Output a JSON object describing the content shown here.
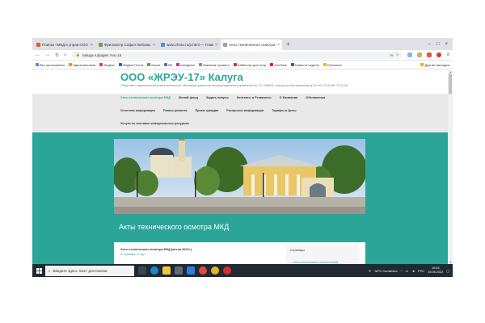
{
  "browser": {
    "tabs": [
      {
        "label": "Поиски «МКД в управ ООО Ж",
        "color": "#e8582c",
        "active": false
      },
      {
        "label": "Фрилансер Софья Любова н",
        "color": "#7a9a4b",
        "active": false
      },
      {
        "label": "www.zhrau.ru/p.html — Главная управ",
        "color": "#4a8fd8",
        "active": false
      },
      {
        "label": "Акты технического осмотра МКД",
        "color": "#9aa0a6",
        "active": true
      }
    ],
    "new_tab": "+",
    "url": "kaluga.ru/pages.?ns=16",
    "zoom": "%",
    "bookmarks": [
      {
        "label": "Вес приложения",
        "color": "#4a8fd8"
      },
      {
        "label": "Одноклассники",
        "color": "#f29100"
      },
      {
        "label": "Яндекс",
        "color": "#e53935"
      },
      {
        "label": "Яндекс.Почта",
        "color": "#1565c0"
      },
      {
        "label": "Кокон",
        "color": "#6a9b2e"
      },
      {
        "label": "ВК",
        "color": "#4c75a3"
      },
      {
        "label": "Instagram",
        "color": "#c13584"
      },
      {
        "label": "Заказчик лучшего",
        "color": "#888888"
      },
      {
        "label": "Шаблоны для отпр",
        "color": "#d32f2f"
      },
      {
        "label": "YouTube",
        "color": "#ff0000"
      },
      {
        "label": "Новости недели",
        "color": "#555555"
      },
      {
        "label": "Полезное",
        "color": "#f4b400"
      }
    ],
    "bookmarks_right": "Другие закладки"
  },
  "site": {
    "title": "ООО «ЖРЭУ-17» Калуга",
    "description": "Общество с ограниченной ответственностью «Жилищно-ремонтно-эксплуатационное управление № 17» 248003, г.Калуга ул.Фестивальная д.23 тел. 72-02-88, 72-01-63",
    "nav_row1": [
      {
        "label": "Акты технического осмотра МКД",
        "current": true
      },
      {
        "label": "Жилой фонд",
        "current": false
      },
      {
        "label": "Задать вопрос",
        "current": false
      },
      {
        "label": "Контакты и Реквизиты",
        "current": false
      },
      {
        "label": "О Компании",
        "current": false
      },
      {
        "label": "Объявления",
        "current": false
      }
    ],
    "nav_row2": [
      "Отчетная информация",
      "Планы ремонта",
      "Прием граждан",
      "Раскрытие информации",
      "Тарифы и Цены"
    ],
    "nav_row3": [
      "Услуги по поставке коммунальных ресурсов"
    ],
    "page_heading": "Акты технического осмотра МКД",
    "article_title": "Акты технического осмотра МКД (весна 2022г.)",
    "article_meta": "м. мухаева, 4 год 1",
    "sidebar_title": "Страницы",
    "sidebar_link": "— Акты технического осмотра МКД"
  },
  "taskbar": {
    "search_placeholder": "Введите здесь текст для поиска",
    "weather": "34°C Солнечно",
    "language": "РУС",
    "time": "10:53",
    "date": "15.06.2022"
  }
}
